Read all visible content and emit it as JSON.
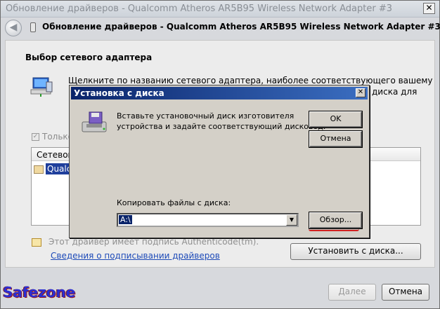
{
  "wizard": {
    "title": "Обновление драйверов - Qualcomm Atheros AR5B95 Wireless Network Adapter #3",
    "header_title": "Обновление драйверов - Qualcomm Atheros AR5B95 Wireless Network Adapter #3",
    "section_title": "Выбор сетевого адаптера",
    "desc_line1": "Щелкните по названию сетевого адаптера, наиболее соответствующего вашему",
    "desc_line2": "диска для",
    "desc_line3": "",
    "only_compat_label": "Только",
    "list_header": "Сетевой",
    "list_item": "Qualco",
    "cert_text": "Этот драйвер имеет подпись Authenticode(tm).",
    "sig_link": "Сведения о подписывании драйверов",
    "install_from_disk_button": "Установить с диска...",
    "next_button": "Далее",
    "cancel_button": "Отмена",
    "close_glyph": "✕"
  },
  "dialog": {
    "title": "Установка с диска",
    "line1": "Вставьте установочный диск изготовителя",
    "line2": "устройства и задайте соответствующий дисковод.",
    "ok_button": "OK",
    "cancel_button": "Отмена",
    "copy_label": "Копировать файлы с диска:",
    "path_value": "A:\\",
    "browse_button": "Обзор...",
    "close_glyph": "✕"
  },
  "watermark": "Safezone",
  "icons": {
    "back": "back-arrow-icon",
    "network_adapter": "network-computer-icon",
    "floppy": "floppy-disk-icon",
    "certificate": "certificate-icon"
  },
  "colors": {
    "dialog_title_start": "#0a246a",
    "dialog_title_end": "#3b6ec1",
    "link": "#1d4ab8",
    "watermark": "#2b2ed3",
    "annotation": "#d01f1f"
  }
}
